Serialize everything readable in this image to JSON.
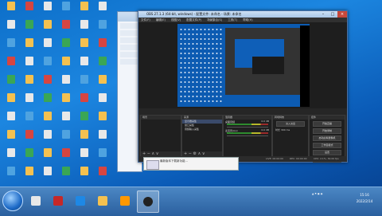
{
  "obs": {
    "title": "OBS 27.1.3 (64-bit, windows) - 配置文件: 未命名 - 场景: 未命名",
    "menu": [
      "文件(F)",
      "编辑(E)",
      "视图(V)",
      "配置文件(P)",
      "场景集合(S)",
      "工具(T)",
      "帮助(H)"
    ],
    "scenes_header": "场景",
    "sources_header": "来源",
    "mixer_header": "混音器",
    "transitions_header": "转场特效",
    "controls_header": "控件",
    "sources": [
      "显示器采集",
      "窗口采集",
      "音频输入采集"
    ],
    "mixer": [
      {
        "name": "桌面音频",
        "level": "0.0 dB"
      },
      {
        "name": "麦克风/Aux",
        "level": "0.0 dB"
      }
    ],
    "transition": {
      "type": "淡入淡出",
      "duration_label": "时长",
      "duration": "300 ms"
    },
    "controls": [
      "开始直播",
      "开始录制",
      "启动虚拟摄像机",
      "工作室模式",
      "设置",
      "退出"
    ],
    "status": {
      "live": "LIVE: 00:00:00",
      "rec": "REC: 00:00:00",
      "cpu": "CPU: 2.1%, 30.00 fps"
    }
  },
  "popup": {
    "text": "最新版本下载新功能..."
  },
  "clock": {
    "time": "15:16",
    "date": "2022/2/14"
  }
}
